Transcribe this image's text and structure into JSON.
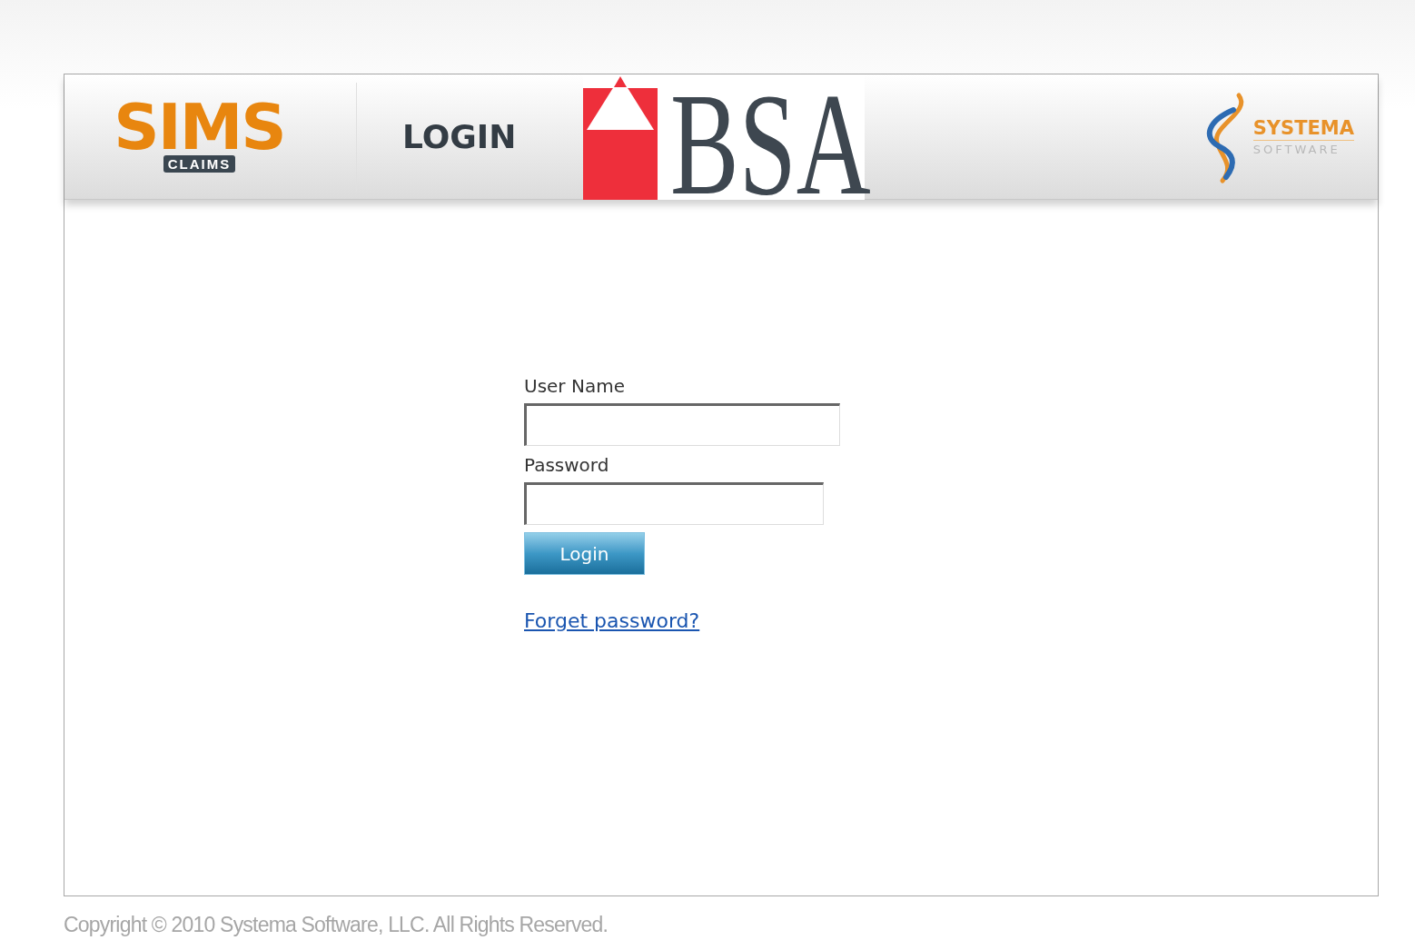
{
  "header": {
    "product_logo": {
      "name": "SIMS",
      "badge": "CLAIMS"
    },
    "title": "LOGIN",
    "client_logo": "BSA",
    "vendor_logo": {
      "name": "SYSTEMA",
      "tagline": "SOFTWARE"
    }
  },
  "form": {
    "fields": [
      {
        "label": "User Name",
        "kind": "text"
      },
      {
        "label": "Password",
        "kind": "password"
      }
    ],
    "submit": "Login",
    "link": "Forget password?"
  },
  "footer": "Copyright © 2010 Systema Software, LLC. All Rights Reserved."
}
